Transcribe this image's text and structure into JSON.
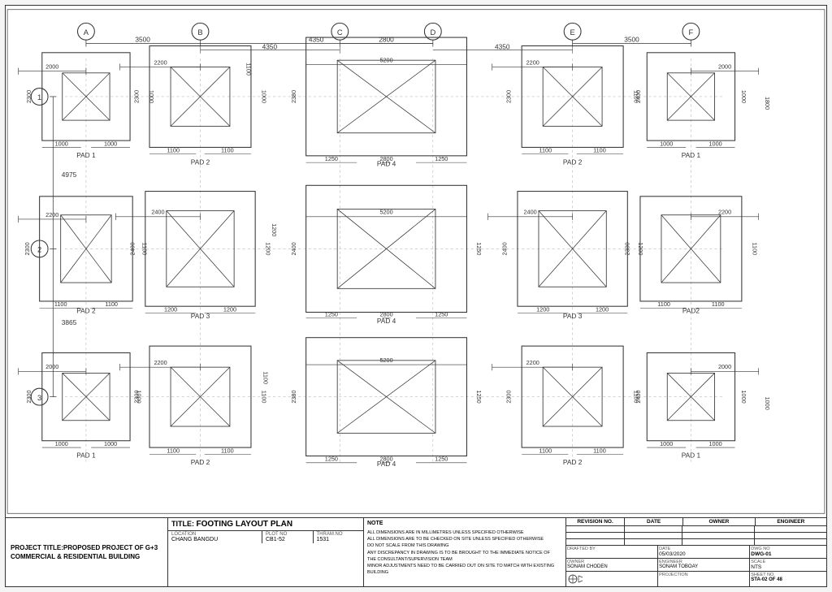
{
  "drawing": {
    "title": "FOOTING LAYOUT PLAN",
    "columns": [
      "A",
      "B",
      "C",
      "D",
      "E",
      "F"
    ],
    "rows": [
      "1",
      "2",
      "3"
    ],
    "dim_top": [
      "3500",
      "4350",
      "2800",
      "4350",
      "3500"
    ],
    "dim_left": [
      "4975",
      "3865"
    ],
    "pad_labels": {
      "r1": [
        "PAD 1",
        "PAD 2",
        "PAD 4",
        "PAD 2",
        "PAD 1"
      ],
      "r2": [
        "PAD 2",
        "PAD 3",
        "PAD 4",
        "PAD 3",
        "PAD2"
      ],
      "r3": [
        "PAD 1",
        "PAD 2",
        "PAD 4",
        "PAD 2",
        "PAD 1"
      ]
    }
  },
  "title_block": {
    "project_title": "PROJECT TITLE:PROPOSED PROJECT OF G+3 COMMERCIAL & RESIDENTIAL BUILDING",
    "title_label": "TITLE:",
    "title_value": "FOOTING LAYOUT PLAN",
    "location_label": "LOCATION",
    "location_value": "CHANG BANGDU",
    "plot_no_label": "PLOT NO",
    "plot_no_value": "CB1-52",
    "thram_no_label": "THRAM.NO",
    "thram_no_value": "1531",
    "note_label": "NOTE",
    "note_text": "ALL DIMENSIONS ARE IN MILLIMETRES UNLESS SPECIFIED OTHERWISE\nALL DIMENSIONS ARE TO BE CHECKED ON SITE UNLESS SPECIFIED OTHERWISE\nDO NOT SCALE FROM THIS DRAWING\nANY DISCREPANCY IN DRAWING IS TO BE BROUGHT TO THE IMMEDIATE NOTICE OF\nTHE CONSULTANT/SUPERVISION TEAM\nMINOR ADJUSTMENTS NEED TO BE CARRIED OUT ON SITE TO MATCH WITH EXISTING BUILDING",
    "revision_no_label": "REVISION NO.",
    "date_label": "DATE",
    "owner_label": "OWNER",
    "engineer_label": "ENGINEER",
    "drafted_by_label": "DRAFTED BY",
    "date2_label": "DATE",
    "dwg_no_label": "DWG NO",
    "date_value": "05/03/2020",
    "dwg_no_value": "DWG-01",
    "owner_value": "SONAM CHODEN",
    "engineer_value": "SONAM TOBOAY",
    "scale_label": "SCALE",
    "scale_value": "NTS",
    "projection_label": "PROJECTION",
    "sheet_no_label": "SHEET NO.",
    "sheet_no_value": "STA-02 OF 48"
  }
}
